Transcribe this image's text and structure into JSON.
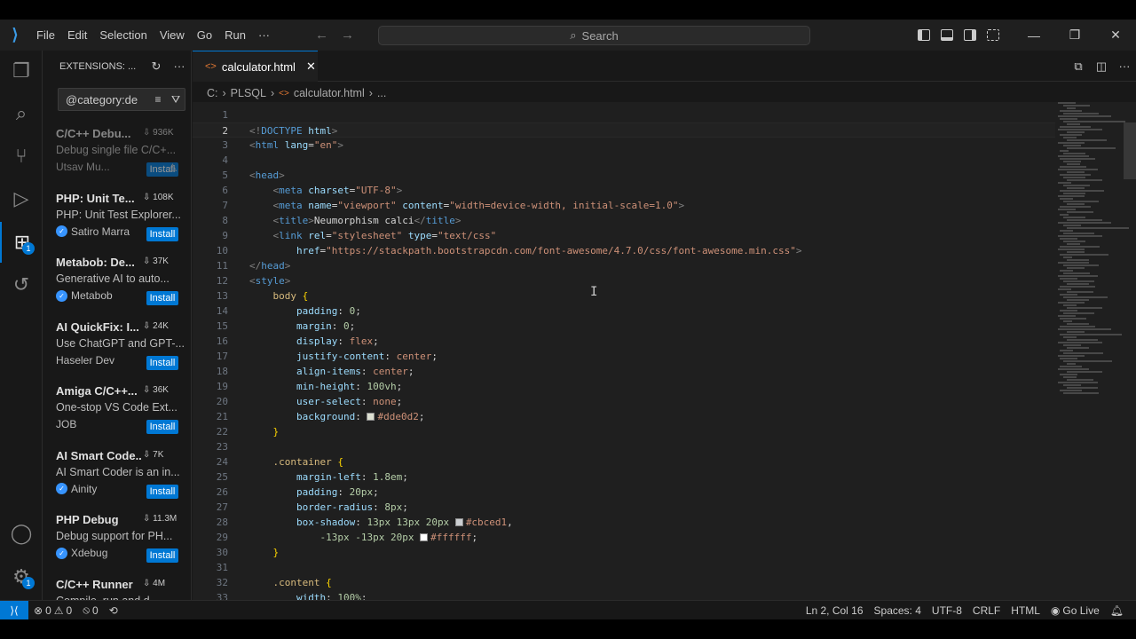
{
  "menu": [
    "File",
    "Edit",
    "Selection",
    "View",
    "Go",
    "Run",
    "···"
  ],
  "search": "Search",
  "window_controls": {
    "minimize": "—",
    "restore": "❐",
    "close": "✕"
  },
  "sidebar": {
    "title": "EXTENSIONS: ...",
    "filter": "@category:de",
    "extensions": [
      {
        "name": "C/C++ Debu...",
        "count": "936K",
        "desc": "Debug single file C/C+...",
        "publisher": "Utsav Mu...",
        "verified": false,
        "button": "Install",
        "dim": true
      },
      {
        "name": "PHP: Unit Te...",
        "count": "108K",
        "desc": "PHP: Unit Test Explorer...",
        "publisher": "Satiro Marra",
        "verified": true,
        "button": "Install"
      },
      {
        "name": "Metabob: De...",
        "count": "37K",
        "desc": "Generative AI to auto...",
        "publisher": "Metabob",
        "verified": true,
        "button": "Install"
      },
      {
        "name": "AI QuickFix: I...",
        "count": "24K",
        "desc": "Use ChatGPT and GPT-...",
        "publisher": "Haseler Dev",
        "verified": false,
        "button": "Install"
      },
      {
        "name": "Amiga C/C++...",
        "count": "36K",
        "desc": "One-stop VS Code Ext...",
        "publisher": "JOB",
        "verified": false,
        "button": "Install"
      },
      {
        "name": "AI Smart Code...",
        "count": "7K",
        "desc": "AI Smart Coder is an in...",
        "publisher": "Ainity",
        "verified": true,
        "button": "Install"
      },
      {
        "name": "PHP Debug",
        "count": "11.3M",
        "desc": "Debug support for PH...",
        "publisher": "Xdebug",
        "verified": true,
        "button": "Install"
      },
      {
        "name": "C/C++ Runner",
        "count": "4M",
        "desc": "Compile, run and d...",
        "publisher": "",
        "verified": false,
        "button": ""
      }
    ]
  },
  "editor": {
    "tab": "calculator.html",
    "breadcrumb": [
      "C:",
      "PLSQL",
      "calculator.html",
      "..."
    ],
    "current_line": 2
  },
  "code_lines": [
    {
      "n": "1",
      "html": ""
    },
    {
      "n": "2",
      "html": "<span class='tg'>&lt;!</span><span class='tn'>DOCTYPE</span> <span class='at'>html</span><span class='tg'>&gt;</span>"
    },
    {
      "n": "3",
      "html": "<span class='tg'>&lt;</span><span class='tn'>html</span> <span class='at'>lang</span>=<span class='st'>\"en\"</span><span class='tg'>&gt;</span>"
    },
    {
      "n": "4",
      "html": ""
    },
    {
      "n": "5",
      "html": "<span class='tg'>&lt;</span><span class='tn'>head</span><span class='tg'>&gt;</span>"
    },
    {
      "n": "6",
      "html": "    <span class='tg'>&lt;</span><span class='tn'>meta</span> <span class='at'>charset</span>=<span class='st'>\"UTF-8\"</span><span class='tg'>&gt;</span>"
    },
    {
      "n": "7",
      "html": "    <span class='tg'>&lt;</span><span class='tn'>meta</span> <span class='at'>name</span>=<span class='st'>\"viewport\"</span> <span class='at'>content</span>=<span class='st'>\"width=device-width, initial-scale=1.0\"</span><span class='tg'>&gt;</span>"
    },
    {
      "n": "8",
      "html": "    <span class='tg'>&lt;</span><span class='tn'>title</span><span class='tg'>&gt;</span>Neumorphism calci<span class='tg'>&lt;/</span><span class='tn'>title</span><span class='tg'>&gt;</span>"
    },
    {
      "n": "9",
      "html": "    <span class='tg'>&lt;</span><span class='tn'>link</span> <span class='at'>rel</span>=<span class='st'>\"stylesheet\"</span> <span class='at'>type</span>=<span class='st'>\"text/css\"</span>"
    },
    {
      "n": "10",
      "html": "        <span class='at'>href</span>=<span class='st'>\"https://stackpath.bootstrapcdn.com/font-awesome/4.7.0/css/font-awesome.min.css\"</span><span class='tg'>&gt;</span>"
    },
    {
      "n": "11",
      "html": "<span class='tg'>&lt;/</span><span class='tn'>head</span><span class='tg'>&gt;</span>"
    },
    {
      "n": "12",
      "html": "<span class='tg'>&lt;</span><span class='tn'>style</span><span class='tg'>&gt;</span>"
    },
    {
      "n": "13",
      "html": "    <span class='sel'>body</span> <span class='br'>{</span>"
    },
    {
      "n": "14",
      "html": "        <span class='pr'>padding</span>: <span class='nu'>0</span>;"
    },
    {
      "n": "15",
      "html": "        <span class='pr'>margin</span>: <span class='nu'>0</span>;"
    },
    {
      "n": "16",
      "html": "        <span class='pr'>display</span>: <span class='vl'>flex</span>;"
    },
    {
      "n": "17",
      "html": "        <span class='pr'>justify-content</span>: <span class='vl'>center</span>;"
    },
    {
      "n": "18",
      "html": "        <span class='pr'>align-items</span>: <span class='vl'>center</span>;"
    },
    {
      "n": "19",
      "html": "        <span class='pr'>min-height</span>: <span class='nu'>100vh</span>;"
    },
    {
      "n": "20",
      "html": "        <span class='pr'>user-select</span>: <span class='vl'>none</span>;"
    },
    {
      "n": "21",
      "html": "        <span class='pr'>background</span>: <span class='sw' style='background:#dde0d2'></span><span class='vl'>#dde0d2</span>;"
    },
    {
      "n": "22",
      "html": "    <span class='br'>}</span>"
    },
    {
      "n": "23",
      "html": ""
    },
    {
      "n": "24",
      "html": "    <span class='sel'>.container</span> <span class='br'>{</span>"
    },
    {
      "n": "25",
      "html": "        <span class='pr'>margin-left</span>: <span class='nu'>1.8em</span>;"
    },
    {
      "n": "26",
      "html": "        <span class='pr'>padding</span>: <span class='nu'>20px</span>;"
    },
    {
      "n": "27",
      "html": "        <span class='pr'>border-radius</span>: <span class='nu'>8px</span>;"
    },
    {
      "n": "28",
      "html": "        <span class='pr'>box-shadow</span>: <span class='nu'>13px 13px 20px</span> <span class='sw' style='background:#cbced1'></span><span class='vl'>#cbced1</span>,"
    },
    {
      "n": "29",
      "html": "            <span class='nu'>-13px -13px 20px</span> <span class='sw' style='background:#ffffff'></span><span class='vl'>#ffffff</span>;"
    },
    {
      "n": "30",
      "html": "    <span class='br'>}</span>"
    },
    {
      "n": "31",
      "html": ""
    },
    {
      "n": "32",
      "html": "    <span class='sel'>.content</span> <span class='br'>{</span>"
    },
    {
      "n": "33",
      "html": "        <span class='pr'>width</span>: <span class='nu'>100%</span>;"
    }
  ],
  "status": {
    "errors": "0",
    "warnings": "0",
    "ports": "0",
    "position": "Ln 2, Col 16",
    "spaces": "Spaces: 4",
    "encoding": "UTF-8",
    "eol": "CRLF",
    "language": "HTML",
    "golive": "Go Live"
  },
  "colors": {
    "accent": "#0078d4",
    "background": "#1f1f1f",
    "sidebar": "#181818"
  }
}
